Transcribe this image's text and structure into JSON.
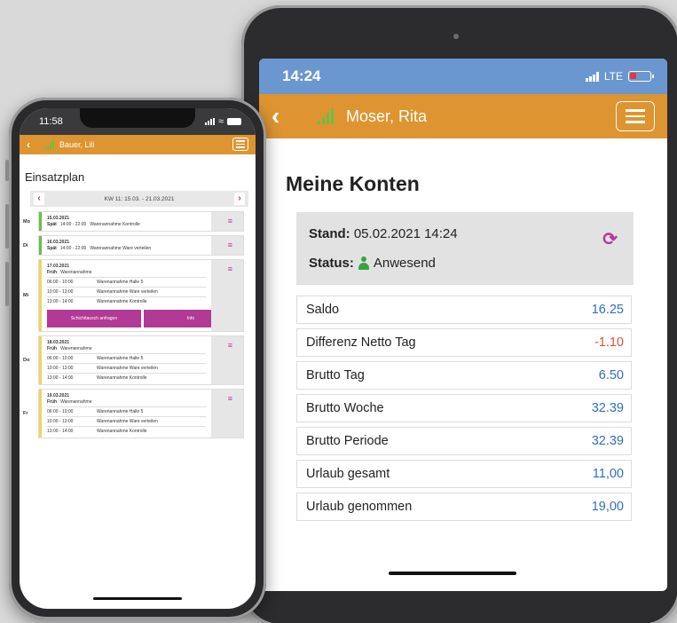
{
  "tablet": {
    "time": "14:24",
    "network": "LTE",
    "user": "Moser, Rita",
    "title": "Meine Konten",
    "stand_label": "Stand:",
    "stand_value": "05.02.2021 14:24",
    "status_label": "Status:",
    "status_value": "Anwesend",
    "accounts": [
      {
        "label": "Saldo",
        "value": "16.25"
      },
      {
        "label": "Differenz Netto Tag",
        "value": "-1.10"
      },
      {
        "label": "Brutto Tag",
        "value": "6.50"
      },
      {
        "label": "Brutto Woche",
        "value": "32.39"
      },
      {
        "label": "Brutto Periode",
        "value": "32.39"
      },
      {
        "label": "Urlaub gesamt",
        "value": "11,00"
      },
      {
        "label": "Urlaub genommen",
        "value": "19,00"
      }
    ]
  },
  "phone": {
    "time": "11:58",
    "user": "Bauer, Lili",
    "title": "Einsatzplan",
    "week": "KW 11: 15.03. - 21.03.2021",
    "days": [
      {
        "label": "Mo",
        "date": "15.03.2021",
        "shift": "Spät",
        "shift_time": "14:00 - 22:00",
        "shift_desc": "Warenannahme Kontrolle"
      },
      {
        "label": "Di",
        "date": "16.03.2021",
        "shift": "Spät",
        "shift_time": "14:00 - 22:00",
        "shift_desc": "Warenannahme Ware verteilen"
      },
      {
        "label": "Mi",
        "date": "17.03.2021",
        "shift": "Früh",
        "shift_desc": "Warenannahme",
        "subs": [
          {
            "time": "06:00 - 10:00",
            "desc": "Warenannahme Halle 5"
          },
          {
            "time": "10:00 - 13:00",
            "desc": "Warenannahme Ware verteilen"
          },
          {
            "time": "13:00 - 14:00",
            "desc": "Warenannahme Kontrolle"
          }
        ],
        "btn_swap": "Schichttausch anfragen",
        "btn_info": "Info"
      },
      {
        "label": "Do",
        "date": "18.03.2021",
        "shift": "Früh",
        "shift_desc": "Warenannahme",
        "subs": [
          {
            "time": "06:00 - 10:00",
            "desc": "Warenannahme Halle 5"
          },
          {
            "time": "10:00 - 13:00",
            "desc": "Warenannahme Ware verteilen"
          },
          {
            "time": "13:00 - 14:00",
            "desc": "Warenannahme Kontrolle"
          }
        ]
      },
      {
        "label": "Fr",
        "date": "19.03.2021",
        "shift": "Früh",
        "shift_desc": "Warenannahme",
        "subs": [
          {
            "time": "06:00 - 10:00",
            "desc": "Warenannahme Halle 5"
          },
          {
            "time": "10:00 - 13:00",
            "desc": "Warenannahme Ware verteilen"
          },
          {
            "time": "13:00 - 14:00",
            "desc": "Warenannahme Kontrolle"
          }
        ]
      }
    ]
  },
  "colors": {
    "nav": "#de9430",
    "status_bar": "#6b97d0",
    "accent": "#b03a96",
    "positive_value": "#2e6fbf",
    "negative_value": "#e0503a",
    "signal": "#6cbe45"
  }
}
